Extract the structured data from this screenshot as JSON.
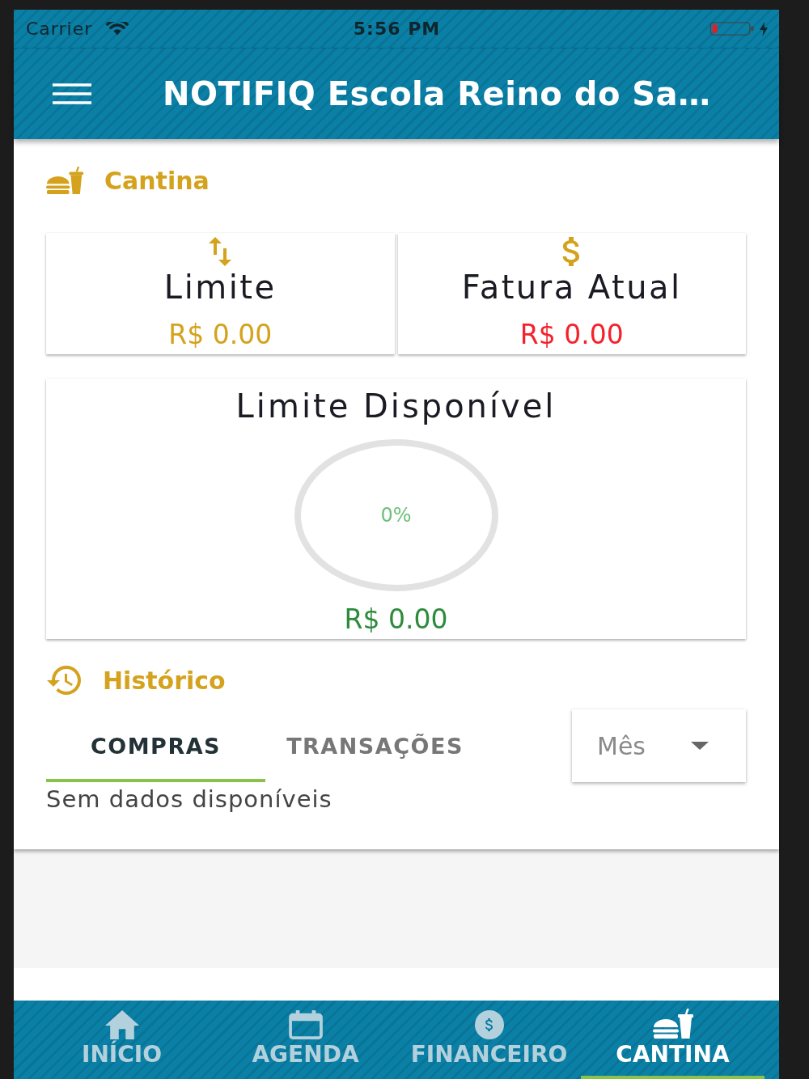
{
  "status_bar": {
    "carrier": "Carrier",
    "time": "5:56 PM"
  },
  "app_bar": {
    "title": "NOTIFIQ Escola Reino do Sa…"
  },
  "section": {
    "title": "Cantina"
  },
  "summary_cards": [
    {
      "kind": "limit",
      "title": "Limite",
      "amount": "R$ 0.00",
      "color": "#d4a21c"
    },
    {
      "kind": "invoice",
      "title": "Fatura Atual",
      "amount": "R$ 0.00",
      "color": "#f5222d"
    }
  ],
  "available_limit": {
    "title": "Limite Disponível",
    "percent": "0%",
    "amount": "R$ 0.00"
  },
  "history": {
    "title": "Histórico",
    "tabs": [
      {
        "label": "COMPRAS",
        "selected": true
      },
      {
        "label": "TRANSAÇÕES",
        "selected": false
      }
    ],
    "period": {
      "placeholder": "Mês"
    },
    "empty_message": "Sem dados disponíveis"
  },
  "bottom_nav": [
    {
      "kind": "home",
      "label": "INÍCIO",
      "selected": false
    },
    {
      "kind": "calendar",
      "label": "AGENDA",
      "selected": false
    },
    {
      "kind": "finance",
      "label": "FINANCEIRO",
      "selected": false
    },
    {
      "kind": "canteen",
      "label": "CANTINA",
      "selected": true
    }
  ]
}
